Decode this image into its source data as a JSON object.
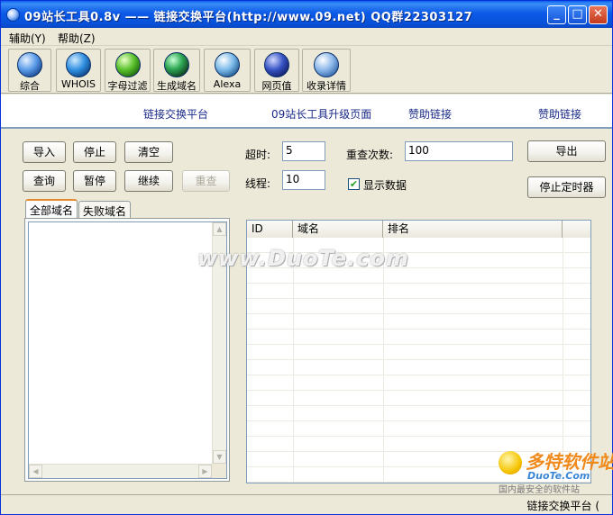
{
  "window": {
    "title": "09站长工具0.8v —— 链接交换平台(http://www.09.net)   QQ群22303127",
    "min_symbol": "_",
    "max_symbol": "□",
    "close_symbol": "✕"
  },
  "menu": {
    "items": [
      {
        "label": "辅助(Y)"
      },
      {
        "label": "帮助(Z)"
      }
    ]
  },
  "toolbar": {
    "tools": [
      {
        "label": "综合",
        "icon": "globe-icon"
      },
      {
        "label": "WHOIS",
        "icon": "globe-icon"
      },
      {
        "label": "字母过滤",
        "icon": "filter-icon"
      },
      {
        "label": "生成域名",
        "icon": "generate-icon"
      },
      {
        "label": "Alexa",
        "icon": "alexa-icon"
      },
      {
        "label": "网页值",
        "icon": "pagerank-icon"
      },
      {
        "label": "收录详情",
        "icon": "index-icon"
      }
    ]
  },
  "banner": {
    "links": [
      {
        "label": "链接交换平台"
      },
      {
        "label": "09站长工具升级页面"
      },
      {
        "label": "赞助链接"
      },
      {
        "label": "赞助链接"
      }
    ]
  },
  "controls": {
    "import_label": "导入",
    "stop_label": "停止",
    "clear_label": "清空",
    "query_label": "查询",
    "pause_label": "暂停",
    "continue_label": "继续",
    "recheck_label": "重查",
    "export_label": "导出",
    "stop_timer_label": "停止定时器",
    "timeout_label": "超时:",
    "timeout_value": "5",
    "threads_label": "线程:",
    "threads_value": "10",
    "retry_label": "重查次数:",
    "retry_value": "100",
    "show_data_label": "显示数据",
    "show_data_checked": "✔"
  },
  "tabs": [
    {
      "label": "全部域名"
    },
    {
      "label": "失败域名"
    }
  ],
  "grid": {
    "columns": [
      "ID",
      "域名",
      "排名"
    ]
  },
  "watermark": "www.DuoTe.com",
  "logo": {
    "title": "多特软件站",
    "subtitle": "DuoTe.Com",
    "tagline": "国内最安全的软件站"
  },
  "status": {
    "text": "链接交换平台 ("
  }
}
